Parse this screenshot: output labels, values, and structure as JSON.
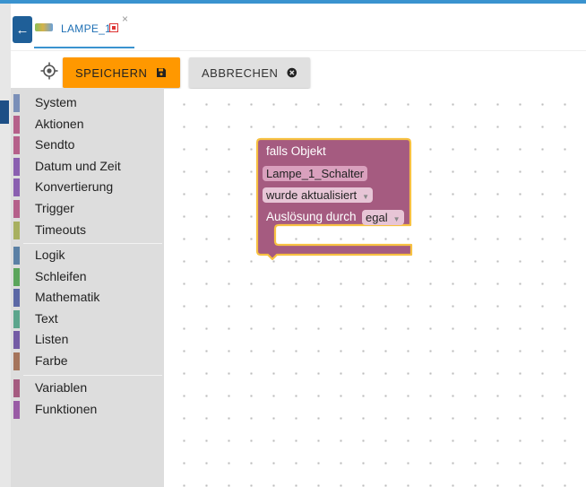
{
  "tab": {
    "label": "LAMPE_1",
    "close": "×"
  },
  "toolbar": {
    "save_label": "SPEICHERN",
    "cancel_label": "ABBRECHEN"
  },
  "sidebar": {
    "groups": [
      [
        {
          "label": "System",
          "color": "#7a8fb8"
        },
        {
          "label": "Aktionen",
          "color": "#b5608a"
        },
        {
          "label": "Sendto",
          "color": "#b5608a"
        },
        {
          "label": "Datum und Zeit",
          "color": "#8a5fb0"
        },
        {
          "label": "Konvertierung",
          "color": "#8a5fb0"
        },
        {
          "label": "Trigger",
          "color": "#b5608a"
        },
        {
          "label": "Timeouts",
          "color": "#a8b060"
        }
      ],
      [
        {
          "label": "Logik",
          "color": "#5b80a5"
        },
        {
          "label": "Schleifen",
          "color": "#5ba55b"
        },
        {
          "label": "Mathematik",
          "color": "#5b67a5"
        },
        {
          "label": "Text",
          "color": "#5ba58c"
        },
        {
          "label": "Listen",
          "color": "#745ba5"
        },
        {
          "label": "Farbe",
          "color": "#a5745b"
        }
      ],
      [
        {
          "label": "Variablen",
          "color": "#a55b80"
        },
        {
          "label": "Funktionen",
          "color": "#995ba5"
        }
      ]
    ]
  },
  "block": {
    "title": "falls Objekt",
    "object": "Lampe_1_Schalter",
    "condition": "wurde aktualisiert",
    "trigger_label": "Auslösung durch",
    "trigger_value": "egal",
    "fill": "#a55b80",
    "outline": "#f7c142"
  }
}
